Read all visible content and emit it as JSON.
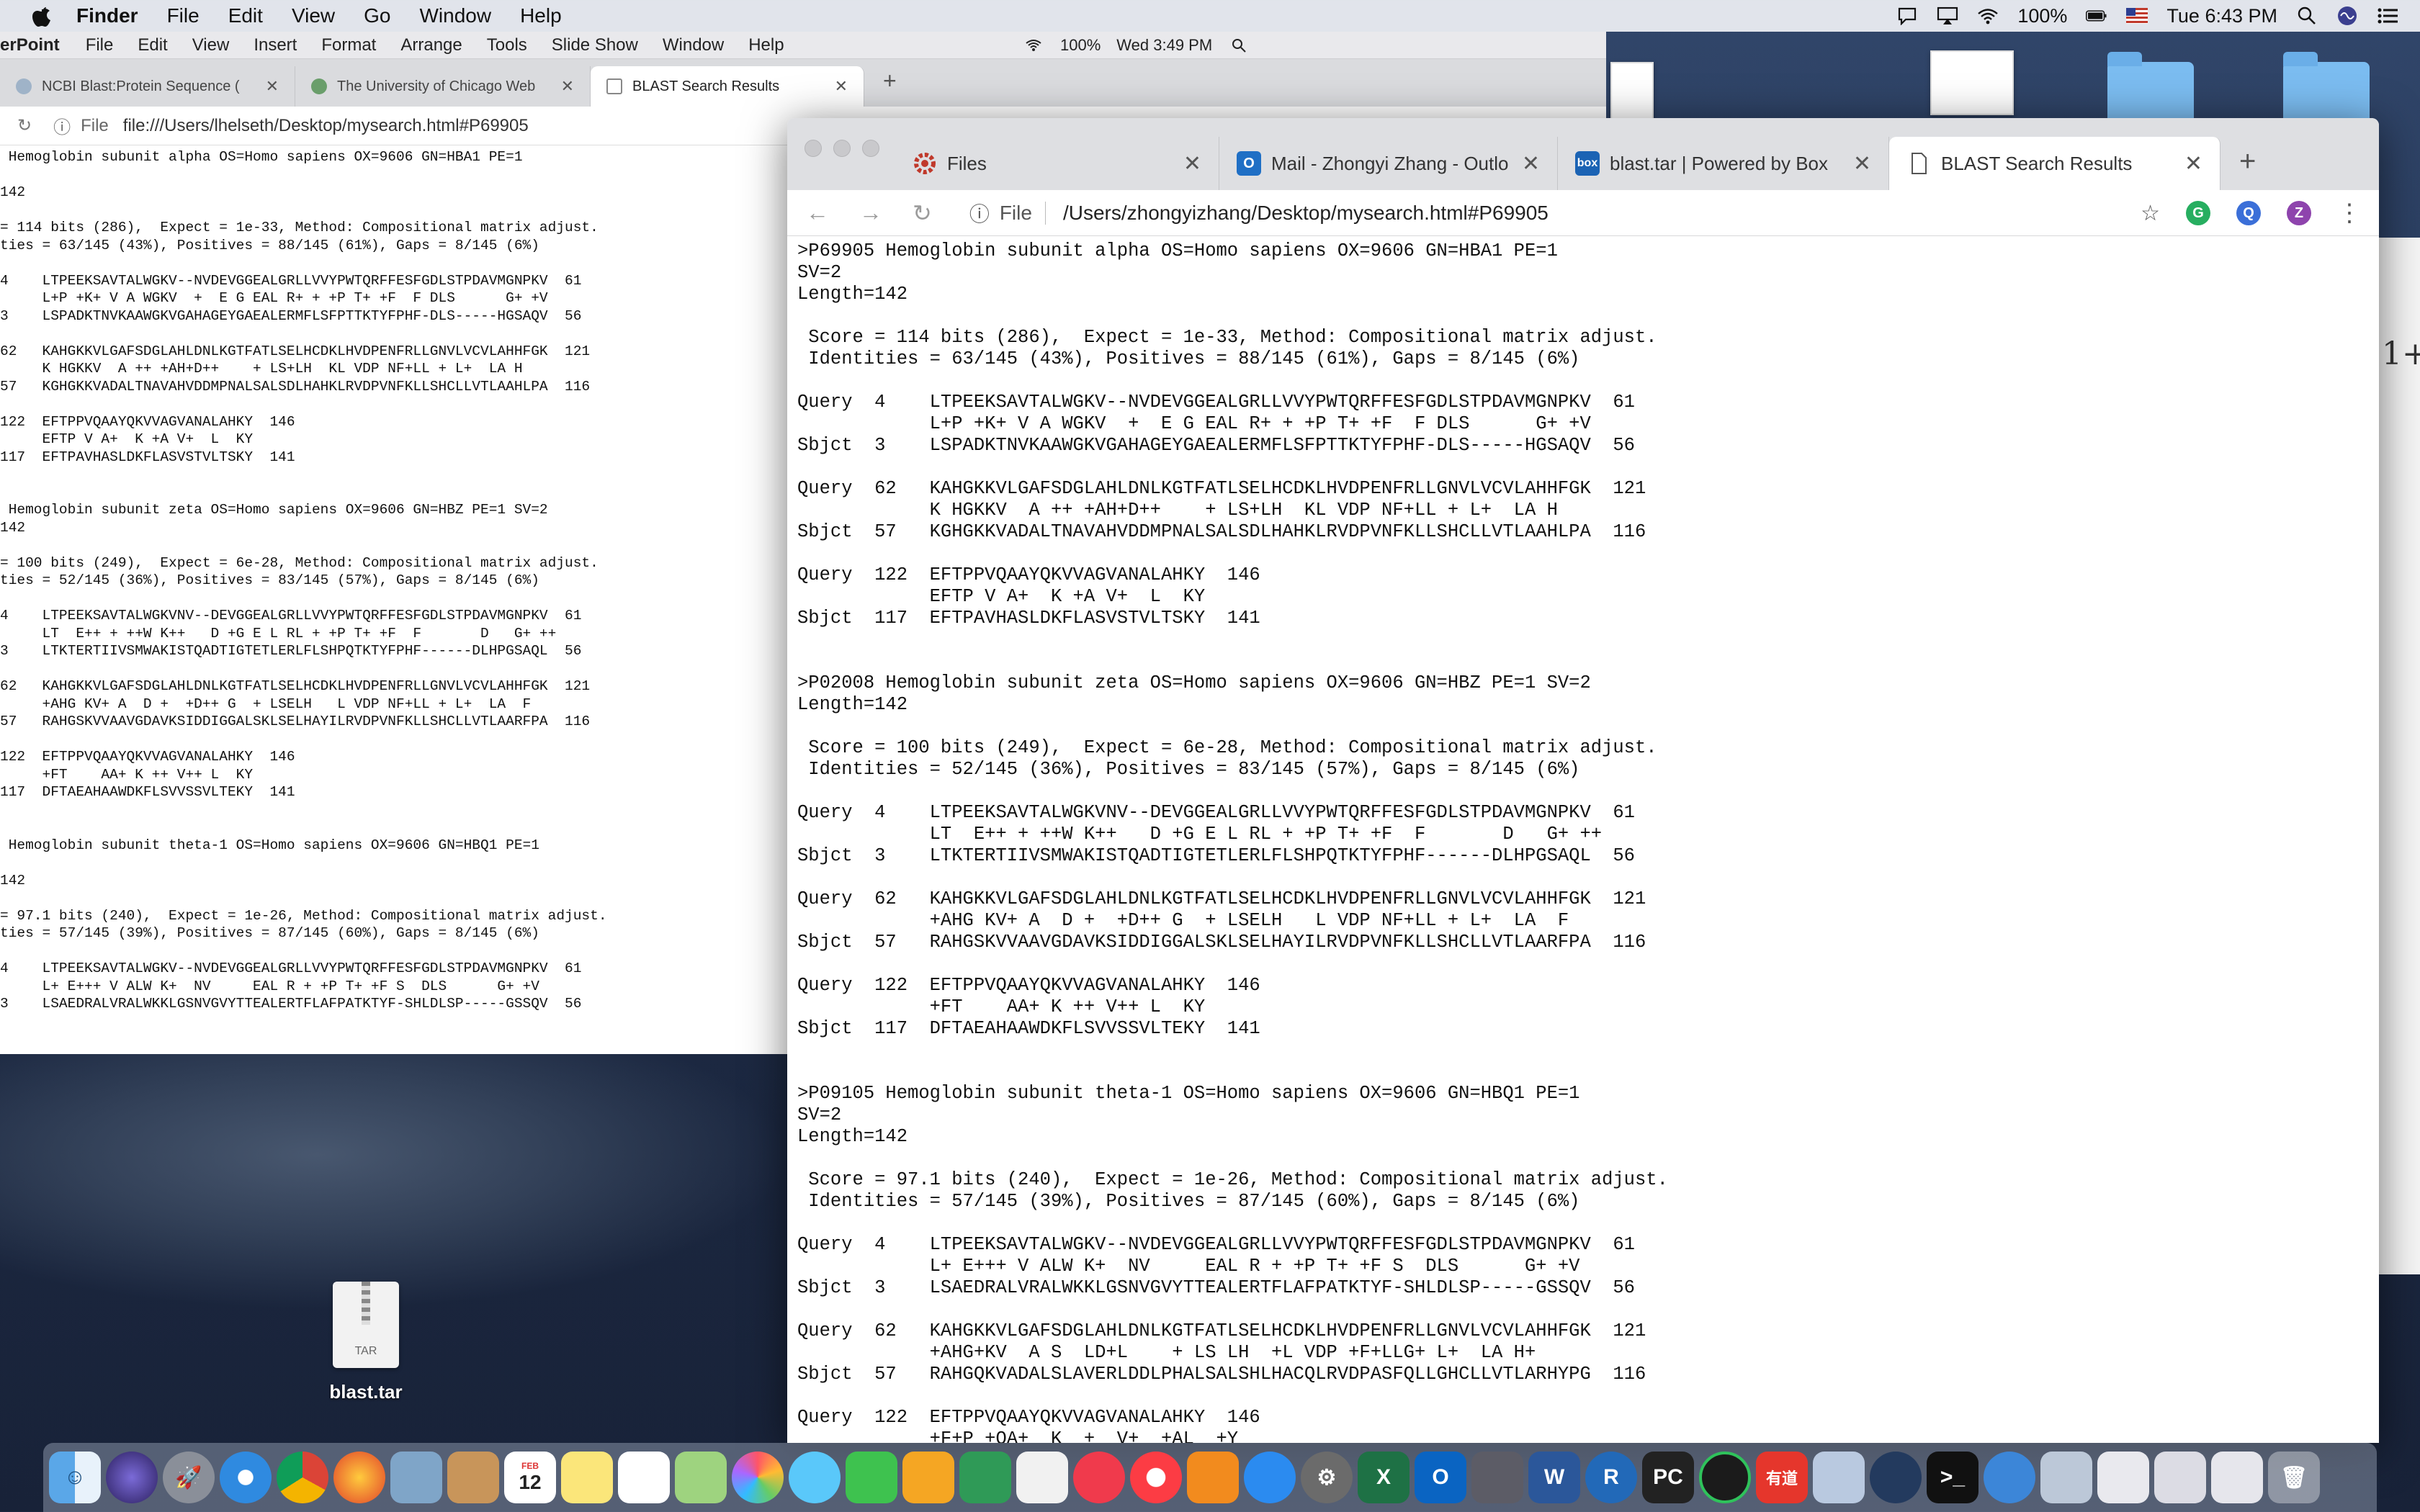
{
  "menubar": {
    "app": "Finder",
    "items": [
      "File",
      "Edit",
      "View",
      "Go",
      "Window",
      "Help"
    ],
    "battery": "100%",
    "clock": "Tue 6:43 PM"
  },
  "back_window": {
    "app_menubar": {
      "app": "erPoint",
      "items": [
        "File",
        "Edit",
        "View",
        "Insert",
        "Format",
        "Arrange",
        "Tools",
        "Slide Show",
        "Window",
        "Help"
      ],
      "battery": "100%",
      "clock": "Wed 3:49 PM"
    },
    "tabs": [
      {
        "label": "NCBI Blast:Protein Sequence (",
        "active": false
      },
      {
        "label": "The University of Chicago Web",
        "active": false
      },
      {
        "label": "BLAST Search Results",
        "active": true
      }
    ],
    "address_prefix": "File",
    "address": "file:///Users/lhelseth/Desktop/mysearch.html#P69905",
    "content": " Hemoglobin subunit alpha OS=Homo sapiens OX=9606 GN=HBA1 PE=1\n\n142\n\n= 114 bits (286),  Expect = 1e-33, Method: Compositional matrix adjust.\nties = 63/145 (43%), Positives = 88/145 (61%), Gaps = 8/145 (6%)\n\n4    LTPEEKSAVTALWGKV--NVDEVGGEALGRLLVVYPWTQRFFESFGDLSTPDAVMGNPKV  61\n     L+P +K+ V A WGKV  +  E G EAL R+ + +P T+ +F  F DLS      G+ +V\n3    LSPADKTNVKAAWGKVGAHAGEYGAEALERMFLSFPTTKTYFPHF-DLS-----HGSAQV  56\n\n62   KAHGKKVLGAFSDGLAHLDNLKGTFATLSELHCDKLHVDPENFRLLGNVLVCVLAHHFGK  121\n     K HGKKV  A ++ +AH+D++    + LS+LH  KL VDP NF+LL + L+  LA H\n57   KGHGKKVADALTNAVAHVDDMPNALSALSDLHAHKLRVDPVNFKLLSHCLLVTLAAHLPA  116\n\n122  EFTPPVQAAYQKVVAGVANALAHKY  146\n     EFTP V A+  K +A V+  L  KY\n117  EFTPAVHASLDKFLASVSTVLTSKY  141\n\n\n Hemoglobin subunit zeta OS=Homo sapiens OX=9606 GN=HBZ PE=1 SV=2\n142\n\n= 100 bits (249),  Expect = 6e-28, Method: Compositional matrix adjust.\nties = 52/145 (36%), Positives = 83/145 (57%), Gaps = 8/145 (6%)\n\n4    LTPEEKSAVTALWGKVNV--DEVGGEALGRLLVVYPWTQRFFESFGDLSTPDAVMGNPKV  61\n     LT  E++ + ++W K++   D +G E L RL + +P T+ +F  F       D   G+ ++\n3    LTKTERTIIVSMWAKISTQADTIGTETLERLFLSHPQTKTYFPHF------DLHPGSAQL  56\n\n62   KAHGKKVLGAFSDGLAHLDNLKGTFATLSELHCDKLHVDPENFRLLGNVLVCVLAHHFGK  121\n     +AHG KV+ A  D +  +D++ G  + LSELH   L VDP NF+LL + L+  LA  F\n57   RAHGSKVVAAVGDAVKSIDDIGGALSKLSELHAYILRVDPVNFKLLSHCLLVTLAARFPA  116\n\n122  EFTPPVQAAYQKVVAGVANALAHKY  146\n     +FT    AA+ K ++ V++ L  KY\n117  DFTAEAHAAWDKFLSVVSSVLTEKY  141\n\n\n Hemoglobin subunit theta-1 OS=Homo sapiens OX=9606 GN=HBQ1 PE=1\n\n142\n\n= 97.1 bits (240),  Expect = 1e-26, Method: Compositional matrix adjust.\nties = 57/145 (39%), Positives = 87/145 (60%), Gaps = 8/145 (6%)\n\n4    LTPEEKSAVTALWGKV--NVDEVGGEALGRLLVVYPWTQRFFESFGDLSTPDAVMGNPKV  61\n     L+ E+++ V ALW K+  NV     EAL R + +P T+ +F S  DLS      G+ +V\n3    LSAEDRALVRALWKKLGSNVGVYTTEALERTFLAFPATKTYF-SHLDLSP-----GSSQV  56"
  },
  "front_window": {
    "tabs": [
      {
        "label": "Files",
        "active": false
      },
      {
        "label": "Mail - Zhongyi Zhang - Outlo",
        "active": false
      },
      {
        "label": "blast.tar | Powered by Box",
        "active": false
      },
      {
        "label": "BLAST Search Results",
        "active": true
      }
    ],
    "new_tab_symbol": "+",
    "address_prefix": "File",
    "address": "/Users/zhongyizhang/Desktop/mysearch.html#P69905",
    "profile_initial": "Z",
    "content": ">P69905 Hemoglobin subunit alpha OS=Homo sapiens OX=9606 GN=HBA1 PE=1\nSV=2\nLength=142\n\n Score = 114 bits (286),  Expect = 1e-33, Method: Compositional matrix adjust.\n Identities = 63/145 (43%), Positives = 88/145 (61%), Gaps = 8/145 (6%)\n\nQuery  4    LTPEEKSAVTALWGKV--NVDEVGGEALGRLLVVYPWTQRFFESFGDLSTPDAVMGNPKV  61\n            L+P +K+ V A WGKV  +  E G EAL R+ + +P T+ +F  F DLS      G+ +V\nSbjct  3    LSPADKTNVKAAWGKVGAHAGEYGAEALERMFLSFPTTKTYFPHF-DLS-----HGSAQV  56\n\nQuery  62   KAHGKKVLGAFSDGLAHLDNLKGTFATLSELHCDKLHVDPENFRLLGNVLVCVLAHHFGK  121\n            K HGKKV  A ++ +AH+D++    + LS+LH  KL VDP NF+LL + L+  LA H\nSbjct  57   KGHGKKVADALTNAVAHVDDMPNALSALSDLHAHKLRVDPVNFKLLSHCLLVTLAAHLPA  116\n\nQuery  122  EFTPPVQAAYQKVVAGVANALAHKY  146\n            EFTP V A+  K +A V+  L  KY\nSbjct  117  EFTPAVHASLDKFLASVSTVLTSKY  141\n\n\n>P02008 Hemoglobin subunit zeta OS=Homo sapiens OX=9606 GN=HBZ PE=1 SV=2\nLength=142\n\n Score = 100 bits (249),  Expect = 6e-28, Method: Compositional matrix adjust.\n Identities = 52/145 (36%), Positives = 83/145 (57%), Gaps = 8/145 (6%)\n\nQuery  4    LTPEEKSAVTALWGKVNV--DEVGGEALGRLLVVYPWTQRFFESFGDLSTPDAVMGNPKV  61\n            LT  E++ + ++W K++   D +G E L RL + +P T+ +F  F       D   G+ ++\nSbjct  3    LTKTERTIIVSMWAKISTQADTIGTETLERLFLSHPQTKTYFPHF------DLHPGSAQL  56\n\nQuery  62   KAHGKKVLGAFSDGLAHLDNLKGTFATLSELHCDKLHVDPENFRLLGNVLVCVLAHHFGK  121\n            +AHG KV+ A  D +  +D++ G  + LSELH   L VDP NF+LL + L+  LA  F\nSbjct  57   RAHGSKVVAAVGDAVKSIDDIGGALSKLSELHAYILRVDPVNFKLLSHCLLVTLAARFPA  116\n\nQuery  122  EFTPPVQAAYQKVVAGVANALAHKY  146\n            +FT    AA+ K ++ V++ L  KY\nSbjct  117  DFTAEAHAAWDKFLSVVSSVLTEKY  141\n\n\n>P09105 Hemoglobin subunit theta-1 OS=Homo sapiens OX=9606 GN=HBQ1 PE=1\nSV=2\nLength=142\n\n Score = 97.1 bits (240),  Expect = 1e-26, Method: Compositional matrix adjust.\n Identities = 57/145 (39%), Positives = 87/145 (60%), Gaps = 8/145 (6%)\n\nQuery  4    LTPEEKSAVTALWGKV--NVDEVGGEALGRLLVVYPWTQRFFESFGDLSTPDAVMGNPKV  61\n            L+ E+++ V ALW K+  NV     EAL R + +P T+ +F S  DLS      G+ +V\nSbjct  3    LSAEDRALVRALWKKLGSNVGVYTTEALERTFLAFPATKTYF-SHLDLSP-----GSSQV  56\n\nQuery  62   KAHGKKVLGAFSDGLAHLDNLKGTFATLSELHCDKLHVDPENFRLLGNVLVCVLAHHFGK  121\n            +AHG+KV  A S  LD+L    + LS LH  +L VDP +F+LLG+ L+  LA H+\nSbjct  57   RAHGQKVADALSLAVERLDDLPHALSALSHLHACQLRVDPASFQLLGHCLLVTLARHYPG  116\n\nQuery  122  EFTPPVQAAYQKVVAGVANALAHKY  146\n            +F+P +QA+  K  +  V+  +AL  +Y"
  },
  "desktop": {
    "file_label": "TAR",
    "file_name": "blast.tar",
    "partial_window_text": "1+"
  },
  "dock": {
    "calendar_month": "FEB",
    "calendar_day": "12",
    "items": [
      "finder",
      "siri",
      "launchpad",
      "safari",
      "chrome",
      "firefox",
      "preview",
      "contacts",
      "calendar",
      "notes",
      "reminders",
      "maps",
      "photos",
      "messages",
      "facetime",
      "keynote",
      "numbers",
      "news",
      "music",
      "books",
      "app-store",
      "system-preferences",
      "excel",
      "outlook",
      "remote-desktop",
      "word",
      "r",
      "pycharm",
      "pycharm-edu",
      "youdao",
      "virtualbox",
      "quicktime",
      "terminal",
      "chrome-alt",
      "preview-alt",
      "docs-1",
      "docs-2",
      "docs-3",
      "docs-4",
      "trash"
    ]
  },
  "colors": {
    "menubar_bg": "#eceef3",
    "desktop_bg": "#26395a",
    "tab_bar": "#dedfe2",
    "dock_bg": "#a0aabe"
  }
}
